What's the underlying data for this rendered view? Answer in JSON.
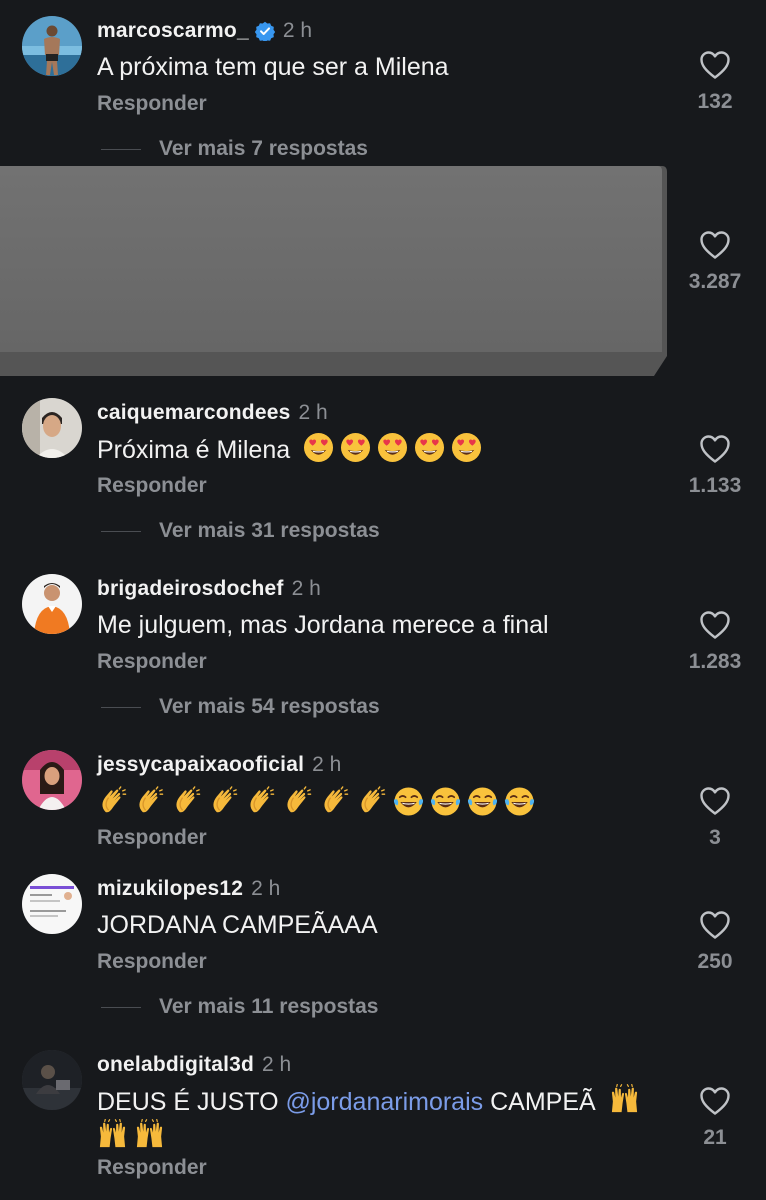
{
  "comments": [
    {
      "username": "marcoscarmo_",
      "verified": true,
      "time": "2 h",
      "text": "A próxima tem que ser a Milena",
      "reply_label": "Responder",
      "likes": "132",
      "more_replies": "Ver mais 7 respostas"
    },
    {
      "username": "",
      "time": "",
      "text": "",
      "likes": "3.287"
    },
    {
      "username": "caiquemarcondees",
      "time": "2 h",
      "text": "Próxima é Milena",
      "emojis": [
        "heart-eyes",
        "heart-eyes",
        "heart-eyes",
        "heart-eyes",
        "heart-eyes"
      ],
      "reply_label": "Responder",
      "likes": "1.133",
      "more_replies": "Ver mais 31 respostas"
    },
    {
      "username": "brigadeirosdochef",
      "time": "2 h",
      "text": "Me julguem, mas Jordana merece a final",
      "reply_label": "Responder",
      "likes": "1.283",
      "more_replies": "Ver mais 54 respostas"
    },
    {
      "username": "jessycapaixaooficial",
      "time": "2 h",
      "emojis": [
        "clap",
        "clap",
        "clap",
        "clap",
        "clap",
        "clap",
        "clap",
        "clap",
        "joy",
        "joy",
        "joy",
        "joy"
      ],
      "reply_label": "Responder",
      "likes": "3"
    },
    {
      "username": "mizukilopes12",
      "time": "2 h",
      "text": "JORDANA CAMPEÃAAA",
      "reply_label": "Responder",
      "likes": "250",
      "more_replies": "Ver mais 11 respostas"
    },
    {
      "username": "onelabdigital3d",
      "time": "2 h",
      "text_before": "DEUS É JUSTO ",
      "mention": "@jordanarimorais",
      "text_after": " CAMPEÃ",
      "emojis": [
        "raised-hands",
        "raised-hands",
        "raised-hands"
      ],
      "reply_label": "Responder",
      "likes": "21"
    }
  ],
  "colors": {
    "background": "#17191c",
    "primary_text": "#f2f2f2",
    "secondary_text": "#8c8f94",
    "mention": "#7b9ce8",
    "verified": "#3897f0",
    "redaction_box": "#6b6b6b"
  }
}
